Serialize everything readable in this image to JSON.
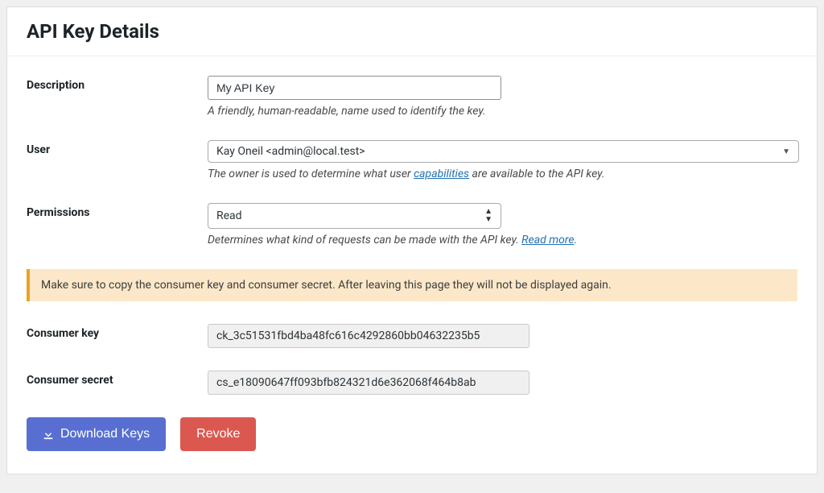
{
  "title": "API Key Details",
  "fields": {
    "description": {
      "label": "Description",
      "value": "My API Key",
      "help": "A friendly, human-readable, name used to identify the key."
    },
    "user": {
      "label": "User",
      "value": "Kay Oneil <admin@local.test>",
      "help_prefix": "The owner is used to determine what user ",
      "help_link": "capabilities",
      "help_suffix": " are available to the API key."
    },
    "permissions": {
      "label": "Permissions",
      "value": "Read",
      "help_prefix": "Determines what kind of requests can be made with the API key. ",
      "help_link": "Read more",
      "help_suffix": "."
    },
    "consumer_key": {
      "label": "Consumer key",
      "value": "ck_3c51531fbd4ba48fc616c4292860bb04632235b5"
    },
    "consumer_secret": {
      "label": "Consumer secret",
      "value": "cs_e18090647ff093bfb824321d6e362068f464b8ab"
    }
  },
  "notice": "Make sure to copy the consumer key and consumer secret. After leaving this page they will not be displayed again.",
  "buttons": {
    "download": "Download Keys",
    "revoke": "Revoke"
  }
}
